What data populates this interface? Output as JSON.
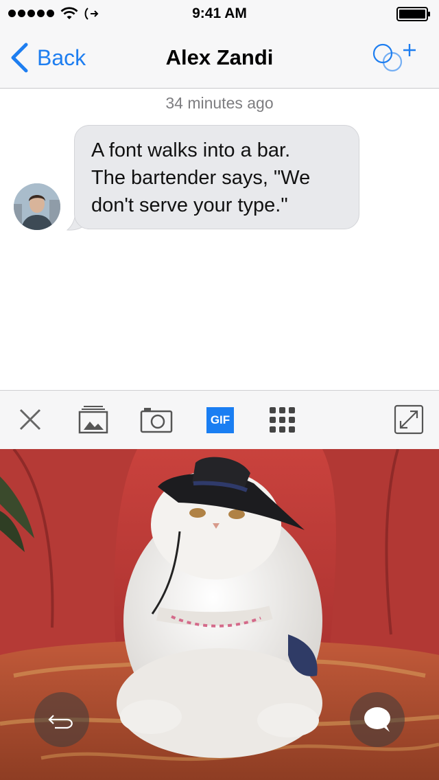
{
  "status_bar": {
    "time": "9:41 AM",
    "signal_icon": "signal-dots-icon",
    "wifi_icon": "wifi-icon",
    "activity_icon": "network-activity-icon",
    "battery_icon": "battery-icon"
  },
  "nav": {
    "back_label": "Back",
    "title": "Alex Zandi",
    "add_icon": "add-to-group-icon",
    "accent_color": "#1e7ef0"
  },
  "conversation": {
    "timestamp": "34 minutes ago",
    "messages": [
      {
        "lines": [
          "A font walks into a bar.",
          "The bartender says, \"We",
          "don't serve your type.\""
        ]
      }
    ]
  },
  "toolbar": {
    "close_icon": "close-icon",
    "gallery_icon": "photo-gallery-icon",
    "camera_icon": "camera-icon",
    "gif_label": "GIF",
    "apps_icon": "grid-apps-icon",
    "expand_icon": "expand-icon",
    "gif_color": "#1a7ef2"
  },
  "preview": {
    "image": "gif-cat-wearing-hat",
    "undo_icon": "undo-icon",
    "send_icon": "chat-bubble-icon"
  }
}
